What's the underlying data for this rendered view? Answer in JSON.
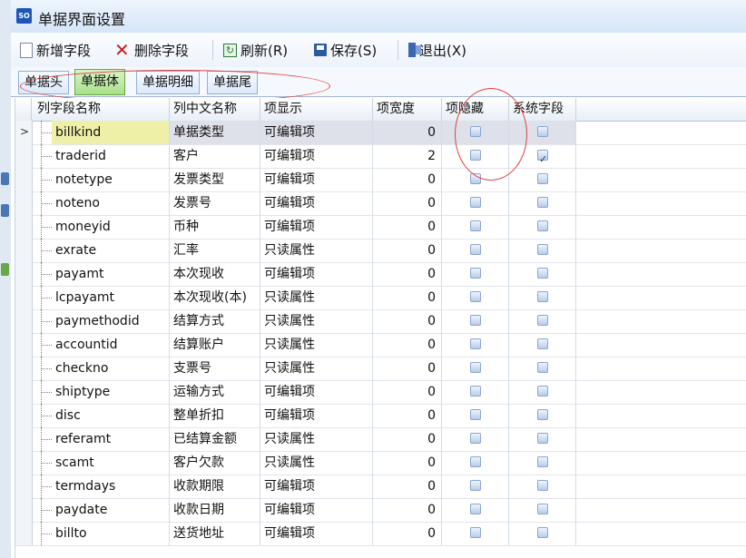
{
  "window": {
    "title": "单据界面设置",
    "icon_text": "SO"
  },
  "toolbar": {
    "new_label": "新增字段",
    "delete_label": "删除字段",
    "refresh_label": "刷新(R)",
    "save_label": "保存(S)",
    "exit_label": "退出(X)"
  },
  "tabs": [
    {
      "label": "单据头",
      "active": false
    },
    {
      "label": "单据体",
      "active": true
    },
    {
      "label": "单据明细",
      "active": false
    },
    {
      "label": "单据尾",
      "active": false
    }
  ],
  "columns": {
    "field_name": "列字段名称",
    "cn_name": "列中文名称",
    "display": "项显示",
    "width": "项宽度",
    "hidden": "项隐藏",
    "system": "系统字段"
  },
  "rows": [
    {
      "field": "billkind",
      "cn": "单据类型",
      "display": "可编辑项",
      "width": "0",
      "hidden": false,
      "system": false,
      "selected": true
    },
    {
      "field": "traderid",
      "cn": "客户",
      "display": "可编辑项",
      "width": "2",
      "hidden": false,
      "system": true
    },
    {
      "field": "notetype",
      "cn": "发票类型",
      "display": "可编辑项",
      "width": "0",
      "hidden": false,
      "system": false
    },
    {
      "field": "noteno",
      "cn": "发票号",
      "display": "可编辑项",
      "width": "0",
      "hidden": false,
      "system": false
    },
    {
      "field": "moneyid",
      "cn": "币种",
      "display": "可编辑项",
      "width": "0",
      "hidden": false,
      "system": false
    },
    {
      "field": "exrate",
      "cn": "汇率",
      "display": "只读属性",
      "width": "0",
      "hidden": false,
      "system": false
    },
    {
      "field": "payamt",
      "cn": "本次现收",
      "display": "可编辑项",
      "width": "0",
      "hidden": false,
      "system": false
    },
    {
      "field": "lcpayamt",
      "cn": "本次现收(本)",
      "display": "只读属性",
      "width": "0",
      "hidden": false,
      "system": false
    },
    {
      "field": "paymethodid",
      "cn": "结算方式",
      "display": "只读属性",
      "width": "0",
      "hidden": false,
      "system": false
    },
    {
      "field": "accountid",
      "cn": "结算账户",
      "display": "只读属性",
      "width": "0",
      "hidden": false,
      "system": false
    },
    {
      "field": "checkno",
      "cn": "支票号",
      "display": "只读属性",
      "width": "0",
      "hidden": false,
      "system": false
    },
    {
      "field": "shiptype",
      "cn": "运输方式",
      "display": "可编辑项",
      "width": "0",
      "hidden": false,
      "system": false
    },
    {
      "field": "disc",
      "cn": "整单折扣",
      "display": "可编辑项",
      "width": "0",
      "hidden": false,
      "system": false
    },
    {
      "field": "referamt",
      "cn": "已结算金额",
      "display": "只读属性",
      "width": "0",
      "hidden": false,
      "system": false
    },
    {
      "field": "scamt",
      "cn": "客户欠款",
      "display": "只读属性",
      "width": "0",
      "hidden": false,
      "system": false
    },
    {
      "field": "termdays",
      "cn": "收款期限",
      "display": "可编辑项",
      "width": "0",
      "hidden": false,
      "system": false
    },
    {
      "field": "paydate",
      "cn": "收款日期",
      "display": "可编辑项",
      "width": "0",
      "hidden": false,
      "system": false
    },
    {
      "field": "billto",
      "cn": "送货地址",
      "display": "可编辑项",
      "width": "0",
      "hidden": false,
      "system": false
    }
  ],
  "colors": {
    "accent": "#1e56b8",
    "active_tab": "#a8e08a",
    "selected_name": "#eef0a8",
    "annotation": "#e04040"
  }
}
